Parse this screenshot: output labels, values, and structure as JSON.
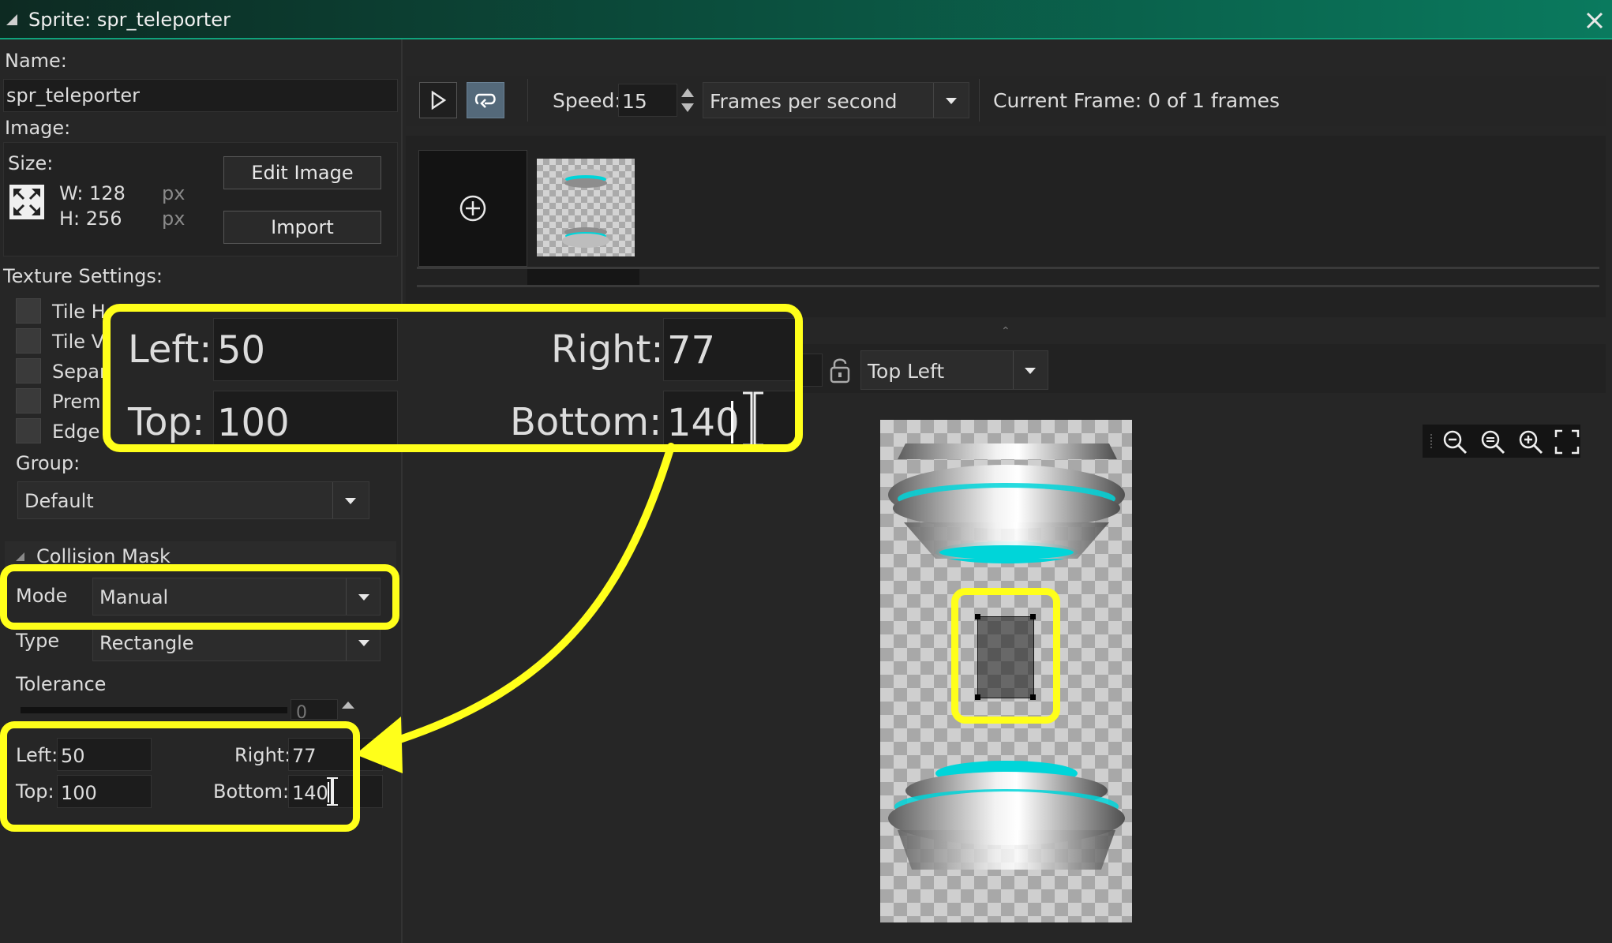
{
  "window": {
    "title": "Sprite: spr_teleporter"
  },
  "left_panel": {
    "name_label": "Name:",
    "name_value": "spr_teleporter",
    "image_label": "Image:",
    "size_label": "Size:",
    "width_label": "W: 128",
    "height_label": "H: 256",
    "px_unit": "px",
    "edit_image_label": "Edit Image",
    "import_label": "Import",
    "texture_settings_label": "Texture Settings:",
    "texture_options": [
      "Tile Ho",
      "Tile Ve",
      "Separ",
      "Prem",
      "Edge"
    ],
    "group_label": "Group:",
    "group_value": "Default",
    "collision_mask": {
      "header": "Collision Mask",
      "mode_label": "Mode",
      "mode_value": "Manual",
      "type_label": "Type",
      "type_value": "Rectangle",
      "tolerance_label": "Tolerance",
      "tolerance_value": "0",
      "left_label": "Left:",
      "left_value": "50",
      "right_label": "Right:",
      "right_value": "77",
      "top_label": "Top:",
      "top_value": "100",
      "bottom_label": "Bottom:",
      "bottom_value": "140"
    }
  },
  "playback": {
    "speed_label": "Speed:",
    "speed_value": "15",
    "speed_unit": "Frames per second",
    "current_frame": "Current Frame: 0 of 1 frames"
  },
  "origin": {
    "value": "Top Left"
  },
  "callout": {
    "left_label": "Left:",
    "left_value": "50",
    "right_label": "Right:",
    "right_value": "77",
    "top_label": "Top:",
    "top_value": "100",
    "bottom_label": "Bottom:",
    "bottom_value": "140"
  },
  "colors": {
    "highlight": "#ffff1a",
    "titlebar_accent": "#0a7a5e",
    "teleporter_glow": "#00d5d9"
  },
  "icons": [
    "play-icon",
    "loop-icon",
    "add-frame-icon",
    "resize-icon",
    "lock-icon",
    "zoom-out-icon",
    "zoom-reset-icon",
    "zoom-in-icon",
    "fullscreen-icon",
    "close-icon"
  ]
}
